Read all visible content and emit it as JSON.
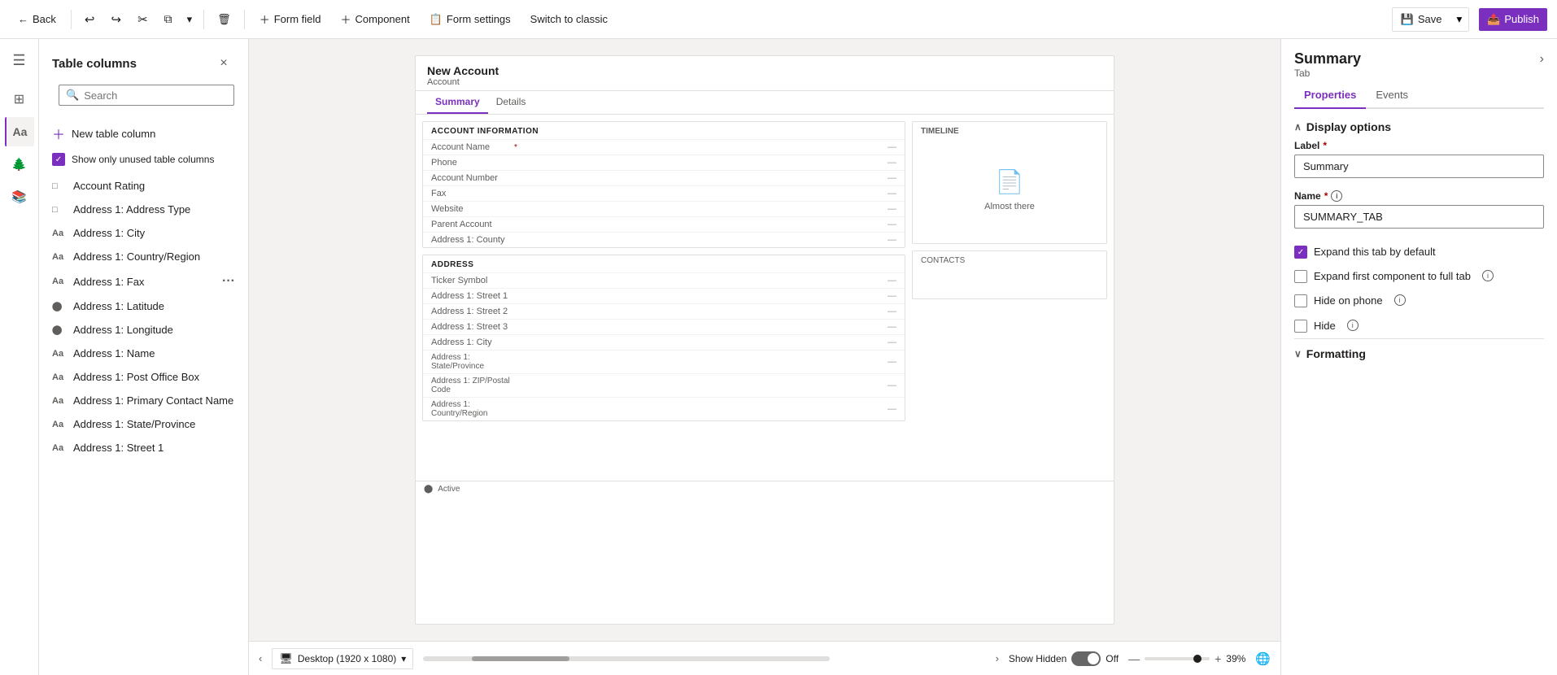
{
  "toolbar": {
    "back_label": "Back",
    "undo_icon": "↩",
    "redo_icon": "↪",
    "cut_icon": "✂",
    "copy_icon": "⧉",
    "dropdown_icon": "▾",
    "delete_icon": "🗑",
    "form_field_label": "Form field",
    "component_label": "Component",
    "form_settings_label": "Form settings",
    "switch_classic_label": "Switch to classic",
    "save_label": "Save",
    "publish_label": "Publish"
  },
  "left_nav": {
    "hamburger": "☰",
    "components_label": "Components",
    "table_columns_label": "Table columns",
    "tree_view_label": "Tree view",
    "form_libraries_label": "Form libraries"
  },
  "side_panel": {
    "title": "Table columns",
    "close": "×",
    "search_placeholder": "Search",
    "new_column_label": "New table column",
    "show_unused_label": "Show only unused table columns",
    "items": [
      {
        "icon": "□",
        "label": "Account Rating"
      },
      {
        "icon": "□",
        "label": "Address 1: Address Type"
      },
      {
        "icon": "Aa",
        "label": "Address 1: City"
      },
      {
        "icon": "Aa",
        "label": "Address 1: Country/Region"
      },
      {
        "icon": "Aa",
        "label": "Address 1: Fax",
        "more": true
      },
      {
        "icon": "⬤",
        "label": "Address 1: Latitude"
      },
      {
        "icon": "⬤",
        "label": "Address 1: Longitude"
      },
      {
        "icon": "Aa",
        "label": "Address 1: Name"
      },
      {
        "icon": "Aa",
        "label": "Address 1: Post Office Box"
      },
      {
        "icon": "Aa",
        "label": "Address 1: Primary Contact Name"
      },
      {
        "icon": "Aa",
        "label": "Address 1: State/Province"
      },
      {
        "icon": "Aa",
        "label": "Address 1: Street 1"
      }
    ]
  },
  "form_preview": {
    "title": "New Account",
    "subtitle": "Account",
    "tabs": [
      "Summary",
      "Details"
    ],
    "active_tab": "Summary",
    "section_account": {
      "header": "ACCOUNT INFORMATION",
      "rows": [
        {
          "label": "Account Name",
          "required": true
        },
        {
          "label": "Phone"
        },
        {
          "label": "Account Number"
        },
        {
          "label": "Fax"
        },
        {
          "label": "Website"
        },
        {
          "label": "Parent Account"
        },
        {
          "label": "Address 1: County"
        }
      ]
    },
    "section_address": {
      "header": "ADDRESS",
      "rows": [
        {
          "label": "Ticker Symbol"
        },
        {
          "label": "Address 1: Street 1"
        },
        {
          "label": "Address 1: Street 2"
        },
        {
          "label": "Address 1: Street 3"
        },
        {
          "label": "Address 1: City"
        },
        {
          "label": "Address 1: State/Province"
        },
        {
          "label": "Address 1: ZIP/Postal Code"
        },
        {
          "label": "Address 1: Country/Region"
        }
      ]
    },
    "timeline_label": "Timeline",
    "almost_there": "Almost there",
    "status_label": "Active"
  },
  "canvas_bottom": {
    "desktop_label": "Desktop (1920 x 1080)",
    "show_hidden_label": "Show Hidden",
    "toggle_state": "Off",
    "zoom_level": "39%"
  },
  "right_panel": {
    "title": "Summary",
    "subtitle": "Tab",
    "chevron": "›",
    "tabs": [
      "Properties",
      "Events"
    ],
    "active_tab": "Properties",
    "display_options": {
      "section_label": "Display options",
      "label_field_label": "Label",
      "label_required": true,
      "label_value": "Summary",
      "name_field_label": "Name",
      "name_required": true,
      "name_value": "SUMMARY_TAB",
      "expand_tab_label": "Expand this tab by default",
      "expand_tab_checked": true,
      "expand_first_label": "Expand first component to full tab",
      "expand_first_checked": false,
      "hide_phone_label": "Hide on phone",
      "hide_phone_checked": false,
      "hide_label": "Hide",
      "hide_checked": false
    },
    "formatting": {
      "section_label": "Formatting"
    }
  }
}
